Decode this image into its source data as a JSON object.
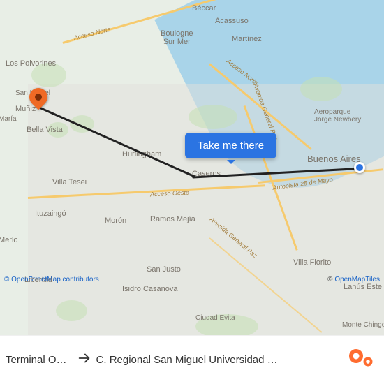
{
  "map": {
    "origin_label": "Buenos Aires",
    "labels": {
      "beccar": "Béccar",
      "acassuso": "Acassuso",
      "boulogne": "Boulogne\nSur Mer",
      "martinez": "Martínez",
      "los_polvorines": "Los Polvorines",
      "san_miguel": "San Miguel",
      "muniz": "Muñiz",
      "maria": "María",
      "bella_vista": "Bella Vista",
      "hurlingham": "Hurlingham",
      "caseros": "Caseros",
      "villa_tesei": "Villa Tesei",
      "ituzaingo": "Ituzaingó",
      "moron": "Morón",
      "ramos_mejia": "Ramos Mejía",
      "merlo": "Merlo",
      "libertad": "Libertad",
      "san_justo": "San Justo",
      "isidro_casanova": "Isidro Casanova",
      "ciudad_evita": "Ciudad Evita",
      "villa_fiorito": "Villa Fiorito",
      "lanus": "Lanús Este",
      "monte": "Monte Chingolo",
      "aeroparque": "Aeroparque\nJorge Newbery",
      "buenos_aires": "Buenos Aires"
    },
    "roads": {
      "acceso_norte": "Acceso Norte",
      "acceso_norte2": "Acceso Norte",
      "av_general_paz": "Avenida General Paz",
      "autopista_25": "Autopista 25 de Mayo",
      "acceso_oeste": "Acceso Oeste",
      "av_general_paz2": "Avenida General Paz"
    }
  },
  "cta": {
    "label": "Take me there"
  },
  "attribution": {
    "osm_prefix": "© ",
    "osm_link": "OpenStreetMap",
    "osm_suffix": " contributors",
    "tiles_prefix": "© ",
    "tiles_link": "OpenMapTiles"
  },
  "footer": {
    "from": "Terminal O…",
    "to": "C. Regional San Miguel Universidad …"
  },
  "colors": {
    "water": "#a9d4e9",
    "cta": "#2b74e2",
    "dest_marker": "#ef6a25"
  }
}
